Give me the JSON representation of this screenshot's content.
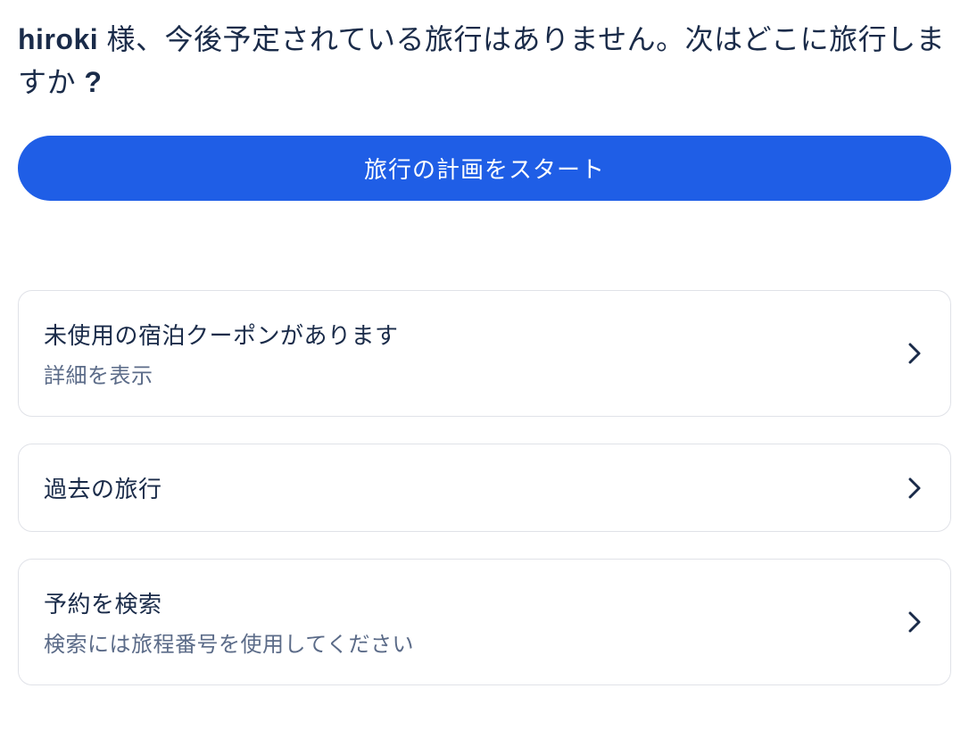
{
  "header": {
    "username": "hiroki",
    "suffix": " 様、今後予定されている旅行はありません。次はどこに旅行しますか",
    "question_mark": " ?"
  },
  "primary_button": {
    "label": "旅行の計画をスタート"
  },
  "cards": [
    {
      "title": "未使用の宿泊クーポンがあります",
      "subtitle": "詳細を表示"
    },
    {
      "title": "過去の旅行",
      "subtitle": ""
    },
    {
      "title": "予約を検索",
      "subtitle": "検索には旅程番号を使用してください"
    }
  ]
}
